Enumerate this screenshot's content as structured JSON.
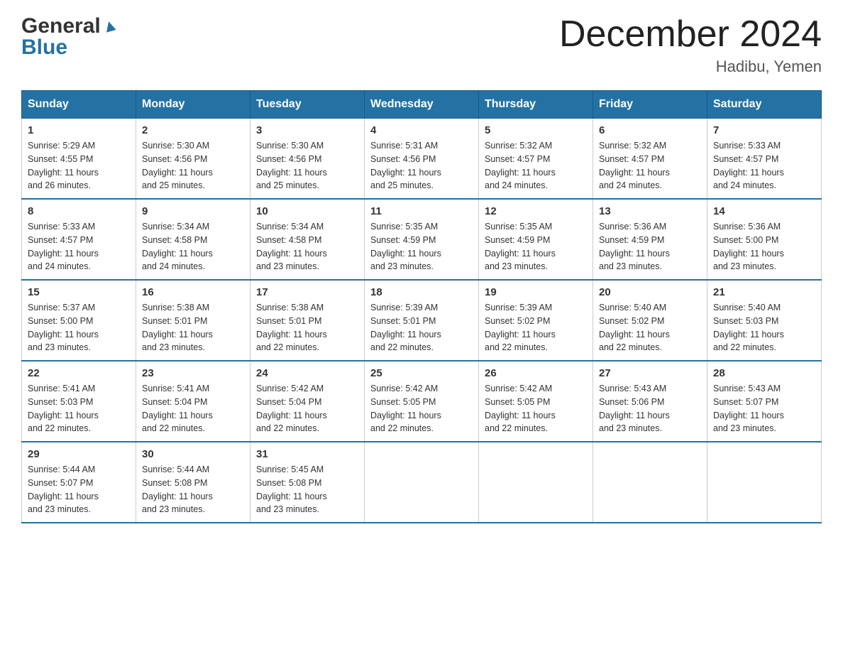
{
  "header": {
    "logo_line1": "General",
    "logo_line2": "Blue",
    "title": "December 2024",
    "location": "Hadibu, Yemen"
  },
  "calendar": {
    "days_of_week": [
      "Sunday",
      "Monday",
      "Tuesday",
      "Wednesday",
      "Thursday",
      "Friday",
      "Saturday"
    ],
    "weeks": [
      [
        {
          "day": "1",
          "sunrise": "5:29 AM",
          "sunset": "4:55 PM",
          "daylight": "11 hours and 26 minutes."
        },
        {
          "day": "2",
          "sunrise": "5:30 AM",
          "sunset": "4:56 PM",
          "daylight": "11 hours and 25 minutes."
        },
        {
          "day": "3",
          "sunrise": "5:30 AM",
          "sunset": "4:56 PM",
          "daylight": "11 hours and 25 minutes."
        },
        {
          "day": "4",
          "sunrise": "5:31 AM",
          "sunset": "4:56 PM",
          "daylight": "11 hours and 25 minutes."
        },
        {
          "day": "5",
          "sunrise": "5:32 AM",
          "sunset": "4:57 PM",
          "daylight": "11 hours and 24 minutes."
        },
        {
          "day": "6",
          "sunrise": "5:32 AM",
          "sunset": "4:57 PM",
          "daylight": "11 hours and 24 minutes."
        },
        {
          "day": "7",
          "sunrise": "5:33 AM",
          "sunset": "4:57 PM",
          "daylight": "11 hours and 24 minutes."
        }
      ],
      [
        {
          "day": "8",
          "sunrise": "5:33 AM",
          "sunset": "4:57 PM",
          "daylight": "11 hours and 24 minutes."
        },
        {
          "day": "9",
          "sunrise": "5:34 AM",
          "sunset": "4:58 PM",
          "daylight": "11 hours and 24 minutes."
        },
        {
          "day": "10",
          "sunrise": "5:34 AM",
          "sunset": "4:58 PM",
          "daylight": "11 hours and 23 minutes."
        },
        {
          "day": "11",
          "sunrise": "5:35 AM",
          "sunset": "4:59 PM",
          "daylight": "11 hours and 23 minutes."
        },
        {
          "day": "12",
          "sunrise": "5:35 AM",
          "sunset": "4:59 PM",
          "daylight": "11 hours and 23 minutes."
        },
        {
          "day": "13",
          "sunrise": "5:36 AM",
          "sunset": "4:59 PM",
          "daylight": "11 hours and 23 minutes."
        },
        {
          "day": "14",
          "sunrise": "5:36 AM",
          "sunset": "5:00 PM",
          "daylight": "11 hours and 23 minutes."
        }
      ],
      [
        {
          "day": "15",
          "sunrise": "5:37 AM",
          "sunset": "5:00 PM",
          "daylight": "11 hours and 23 minutes."
        },
        {
          "day": "16",
          "sunrise": "5:38 AM",
          "sunset": "5:01 PM",
          "daylight": "11 hours and 23 minutes."
        },
        {
          "day": "17",
          "sunrise": "5:38 AM",
          "sunset": "5:01 PM",
          "daylight": "11 hours and 22 minutes."
        },
        {
          "day": "18",
          "sunrise": "5:39 AM",
          "sunset": "5:01 PM",
          "daylight": "11 hours and 22 minutes."
        },
        {
          "day": "19",
          "sunrise": "5:39 AM",
          "sunset": "5:02 PM",
          "daylight": "11 hours and 22 minutes."
        },
        {
          "day": "20",
          "sunrise": "5:40 AM",
          "sunset": "5:02 PM",
          "daylight": "11 hours and 22 minutes."
        },
        {
          "day": "21",
          "sunrise": "5:40 AM",
          "sunset": "5:03 PM",
          "daylight": "11 hours and 22 minutes."
        }
      ],
      [
        {
          "day": "22",
          "sunrise": "5:41 AM",
          "sunset": "5:03 PM",
          "daylight": "11 hours and 22 minutes."
        },
        {
          "day": "23",
          "sunrise": "5:41 AM",
          "sunset": "5:04 PM",
          "daylight": "11 hours and 22 minutes."
        },
        {
          "day": "24",
          "sunrise": "5:42 AM",
          "sunset": "5:04 PM",
          "daylight": "11 hours and 22 minutes."
        },
        {
          "day": "25",
          "sunrise": "5:42 AM",
          "sunset": "5:05 PM",
          "daylight": "11 hours and 22 minutes."
        },
        {
          "day": "26",
          "sunrise": "5:42 AM",
          "sunset": "5:05 PM",
          "daylight": "11 hours and 22 minutes."
        },
        {
          "day": "27",
          "sunrise": "5:43 AM",
          "sunset": "5:06 PM",
          "daylight": "11 hours and 23 minutes."
        },
        {
          "day": "28",
          "sunrise": "5:43 AM",
          "sunset": "5:07 PM",
          "daylight": "11 hours and 23 minutes."
        }
      ],
      [
        {
          "day": "29",
          "sunrise": "5:44 AM",
          "sunset": "5:07 PM",
          "daylight": "11 hours and 23 minutes."
        },
        {
          "day": "30",
          "sunrise": "5:44 AM",
          "sunset": "5:08 PM",
          "daylight": "11 hours and 23 minutes."
        },
        {
          "day": "31",
          "sunrise": "5:45 AM",
          "sunset": "5:08 PM",
          "daylight": "11 hours and 23 minutes."
        },
        null,
        null,
        null,
        null
      ]
    ],
    "labels": {
      "sunrise": "Sunrise:",
      "sunset": "Sunset:",
      "daylight": "Daylight:"
    }
  }
}
